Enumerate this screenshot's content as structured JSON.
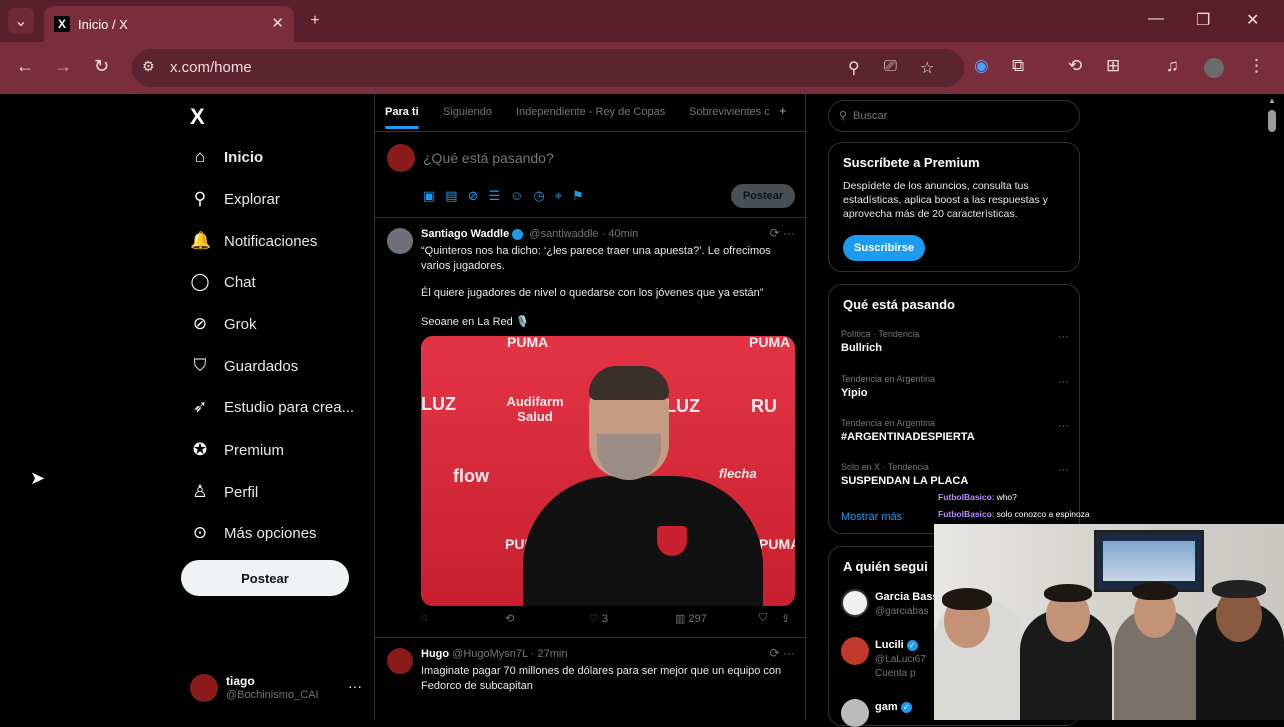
{
  "browser": {
    "tab_title": "Inicio / X",
    "tab_icon": "X",
    "new_tab": "+",
    "url": "x.com/home"
  },
  "sidebar": {
    "logo": "X",
    "items": [
      {
        "label": "Inicio",
        "icon": "home-icon",
        "glyph": "⌂"
      },
      {
        "label": "Explorar",
        "icon": "search-icon",
        "glyph": "⚲"
      },
      {
        "label": "Notificaciones",
        "icon": "bell-icon",
        "glyph": "🔔"
      },
      {
        "label": "Chat",
        "icon": "chat-icon",
        "glyph": "◯"
      },
      {
        "label": "Grok",
        "icon": "grok-icon",
        "glyph": "⊘"
      },
      {
        "label": "Guardados",
        "icon": "bookmark-icon",
        "glyph": "⛉"
      },
      {
        "label": "Estudio para crea...",
        "icon": "rocket-icon",
        "glyph": "➶"
      },
      {
        "label": "Premium",
        "icon": "premium-icon",
        "glyph": "✪"
      },
      {
        "label": "Perfil",
        "icon": "person-icon",
        "glyph": "♙"
      },
      {
        "label": "Más opciones",
        "icon": "more-circle-icon",
        "glyph": "⊙"
      }
    ],
    "post_button": "Postear",
    "user": {
      "name": "tiago",
      "handle": "@Bochinismo_CAI"
    }
  },
  "feed": {
    "tabs": [
      "Para ti",
      "Siguiendo",
      "Independiente - Rey de Copas",
      "Sobrevivientes c"
    ],
    "compose_placeholder": "¿Qué está pasando?",
    "compose_post": "Postear",
    "tweets": [
      {
        "name": "Santiago Waddle",
        "handle": "@santiwaddle",
        "time": "· 40min",
        "lines": [
          "“Quinteros nos ha dicho: ‘¿les parece traer una apuesta?’. Le ofrecimos varios jugadores.",
          "Él quiere jugadores de nivel o quedarse con los jóvenes que ya están”",
          "Seoane en La Red 🎙️"
        ],
        "media_text": [
          "PUMA",
          "PUMA",
          "LUZ",
          "Audifarm Salud",
          "LUZ",
          "RU",
          "flow",
          "flecha",
          "PUMA",
          "PUMA"
        ],
        "likes": "3",
        "views": "297"
      },
      {
        "name": "Hugo",
        "handle": "@HugoMysn7L",
        "time": "· 27min",
        "lines": [
          "Imaginate pagar 70 millones de dólares para ser mejor que un equipo con Fedorco de subcapitan"
        ]
      }
    ]
  },
  "right": {
    "search_placeholder": "Buscar",
    "premium": {
      "title": "Suscríbete a Premium",
      "desc": "Despídete de los anuncios, consulta tus estadísticas, aplica boost a las respuestas y aprovecha más de 20 características.",
      "button": "Suscribirse"
    },
    "trends_title": "Qué está pasando",
    "trends": [
      {
        "meta": "Política · Tendencia",
        "title": "Bullrich"
      },
      {
        "meta": "Tendencia en Argentina",
        "title": "Yipio"
      },
      {
        "meta": "Tendencia en Argentina",
        "title": "#ARGENTINADESPIERTA"
      },
      {
        "meta": "Solo en X · Tendencia",
        "title": "SUSPENDAN LA PLACA"
      }
    ],
    "show_more": "Mostrar más",
    "follow_title": "A quién segui",
    "follow": [
      {
        "name": "Garcia Bass",
        "handle": "@garciabas"
      },
      {
        "name": "Lucili",
        "handle": "@LaLuci67",
        "extra": "Cuenta p"
      },
      {
        "name": "gam",
        "handle": ""
      }
    ]
  },
  "stream_chat": [
    {
      "user": "FutbolBasico",
      "msg": ": who?"
    },
    {
      "user": "FutbolBasico",
      "msg": ": solo conozco a espinoza"
    }
  ],
  "colors": {
    "accent": "#1d9bf0",
    "browser_frame": "#7a2d3b",
    "background": "#000000"
  }
}
